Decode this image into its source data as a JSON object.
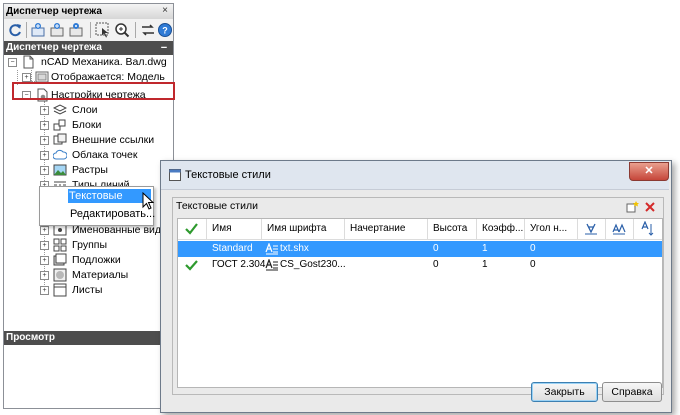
{
  "drawing_manager": {
    "title": "Диспетчер чертежа",
    "close_glyph": "×",
    "section_title": "Диспетчер чертежа",
    "section_collapse_glyph": "−",
    "bottom_section_title": "Просмотр",
    "toolbar_icons": [
      "refresh-icon",
      "add-viewport-icon",
      "add-element-icon",
      "toggle-visibility-icon",
      "select-icon",
      "zoom-icon",
      "swap-icon",
      "help-icon"
    ],
    "tree": {
      "root": "nCAD Механика. Вал.dwg",
      "displayed": "Отображается: Модель",
      "settings": "Настройки чертежа",
      "items": [
        "Слои",
        "Блоки",
        "Внешние ссылки",
        "Облака точек",
        "Растры",
        "Типы линий",
        "Текстовые стили",
        "Именованные виды",
        "Группы",
        "Подложки",
        "Материалы",
        "Листы"
      ]
    },
    "context_menu": {
      "selected_item": "Текстовые стили",
      "edit_item": "Редактировать..."
    }
  },
  "dialog": {
    "title": "Текстовые стили",
    "close_glyph": "✕",
    "group_label": "Текстовые стили",
    "columns": [
      "Имя",
      "Имя шрифта",
      "Начертание",
      "Высота",
      "Коэфф...",
      "Угол н..."
    ],
    "rows": [
      {
        "current": false,
        "name": "Standard",
        "font": "txt.shx",
        "style": "",
        "height": "0",
        "factor": "1",
        "angle": "0",
        "selected": true
      },
      {
        "current": true,
        "name": "ГОСТ 2.304",
        "font": "CS_Gost230...",
        "style": "",
        "height": "0",
        "factor": "1",
        "angle": "0",
        "selected": false
      }
    ],
    "buttons": {
      "close": "Закрыть",
      "help": "Справка"
    },
    "colors": {
      "selection": "#3399ff",
      "check": "#2e9a2e",
      "delete": "#d42a2a",
      "highlight_frame": "#c0282d"
    }
  }
}
